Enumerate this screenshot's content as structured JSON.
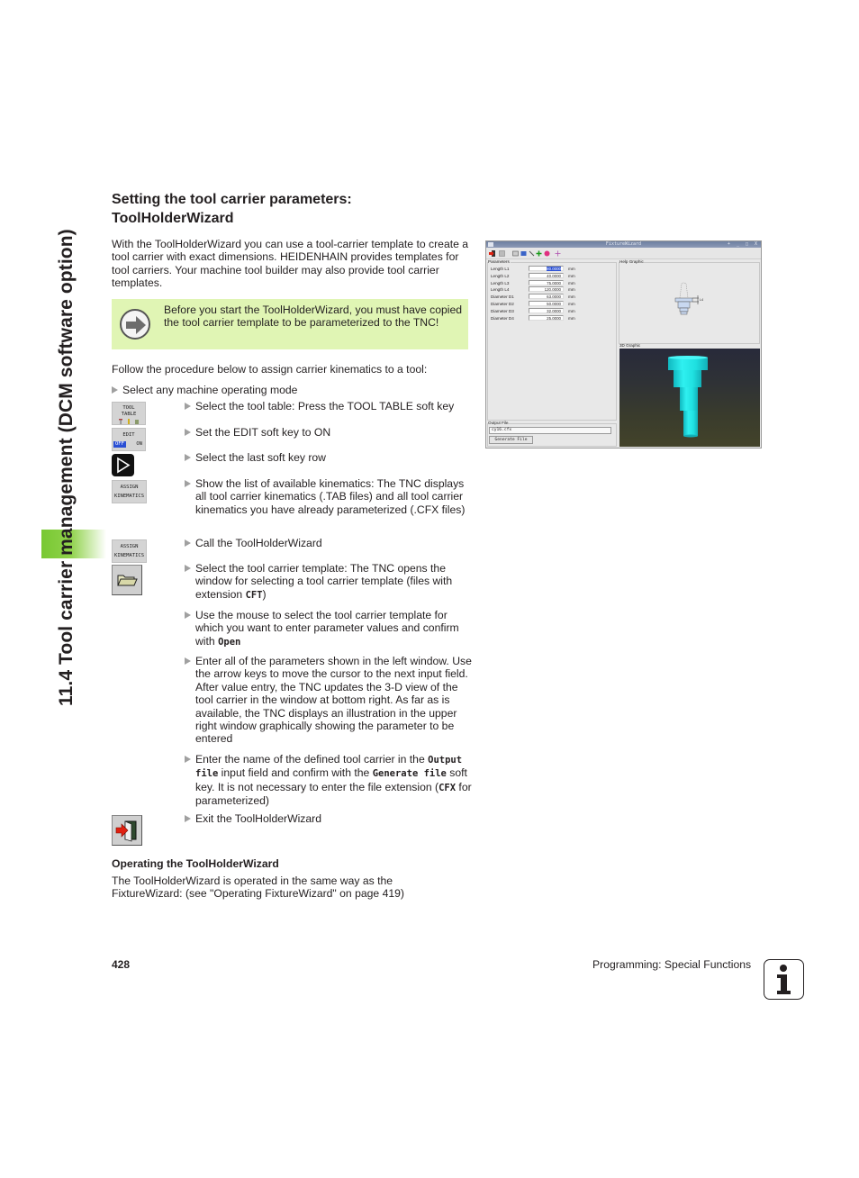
{
  "side_title": "11.4 Tool carrier management (DCM software option)",
  "heading": "Setting the tool carrier parameters: ToolHolderWizard",
  "intro": "With the ToolHolderWizard you can use a tool-carrier template to create a tool carrier with exact dimensions. HEIDENHAIN provides templates for tool carriers. Your machine tool builder may also provide tool carrier templates.",
  "note": {
    "icon": "arrow-right-circle-icon",
    "text": "Before you start the ToolHolderWizard, you must have copied the tool carrier template to be parameterized to the TNC!"
  },
  "follow": "Follow the procedure below to assign carrier kinematics to a tool:",
  "steps": [
    {
      "text": "Select any machine operating mode"
    },
    {
      "softkey": [
        "TOOL",
        "TABLE"
      ],
      "text": "Select the tool table: Press the TOOL TABLE soft key"
    },
    {
      "softkey": [
        "EDIT"
      ],
      "toggle": [
        "OFF",
        "ON"
      ],
      "text": "Set the EDIT soft key to ON"
    },
    {
      "softkey_icon": "next-row-icon",
      "text": "Select the last soft key row"
    },
    {
      "softkey": [
        "ASSIGN",
        "KINEMATICS"
      ],
      "text": "Show the list of available kinematics: The TNC displays all tool carrier kinematics (.TAB files) and all tool carrier kinematics you have already parameterized (.CFX files)"
    },
    {
      "softkey": [
        "ASSIGN",
        "KINEMATICS"
      ],
      "text": "Call the ToolHolderWizard"
    },
    {
      "softkey_icon": "folder-open-icon",
      "text_before": "Select the tool carrier template: The TNC opens the window for selecting a tool carrier template (files with extension ",
      "code": "CFT",
      "text_after": ")"
    },
    {
      "text_before": "Use the mouse to select the tool carrier template for which you want to enter parameter values and confirm with ",
      "code": "Open"
    },
    {
      "text": "Enter all of the parameters shown in the left window. Use the arrow keys to move the cursor to the next input field. After value entry, the TNC updates the 3-D view of the tool carrier in the window at bottom right. As far as is available, the TNC displays an illustration in the upper right window graphically showing the parameter to be entered"
    },
    {
      "text_a": "Enter the name of the defined tool carrier in the ",
      "code_a": "Output file",
      "text_b": " input field and confirm with the ",
      "code_b": "Generate file",
      "text_c": " soft key. It is not necessary to enter the file extension (",
      "code_c": "CFX",
      "text_d": " for parameterized)"
    },
    {
      "softkey_icon": "exit-door-icon",
      "text": "Exit the ToolHolderWizard"
    }
  ],
  "subheading": "Operating the ToolHolderWizard",
  "subtext": "The ToolHolderWizard is operated in the same way as the FixtureWizard: (see \"Operating FixtureWizard\" on page 419)",
  "screenshot": {
    "window_title": "FixtureWizard",
    "window_controls": "+ _ □ X",
    "parameters_label": "Parameters",
    "parameters": [
      {
        "label": "Length L1",
        "value": "80.0000",
        "unit": "mm",
        "selected": true
      },
      {
        "label": "Length L2",
        "value": "40.0000",
        "unit": "mm"
      },
      {
        "label": "Length L3",
        "value": "75.0000",
        "unit": "mm"
      },
      {
        "label": "Length L4",
        "value": "120.0000",
        "unit": "mm"
      },
      {
        "label": "Diameter D1",
        "value": "63.0000",
        "unit": "mm"
      },
      {
        "label": "Diameter D2",
        "value": "50.0000",
        "unit": "mm"
      },
      {
        "label": "Diameter D3",
        "value": "32.0000",
        "unit": "mm"
      },
      {
        "label": "Diameter D4",
        "value": "25.0000",
        "unit": "mm"
      }
    ],
    "help_label": "Help Graphic",
    "help_dim": "L4",
    "graphic3d_label": "3D Graphic",
    "output_label": "Output File",
    "output_value": "cy16.cfx",
    "generate_label": "Generate File",
    "colors": {
      "tool_3d": "#1fe0e0",
      "help_fill": "#c8d8f0"
    }
  },
  "footer": {
    "page": "428",
    "section": "Programming: Special Functions",
    "icon": "info-icon"
  }
}
